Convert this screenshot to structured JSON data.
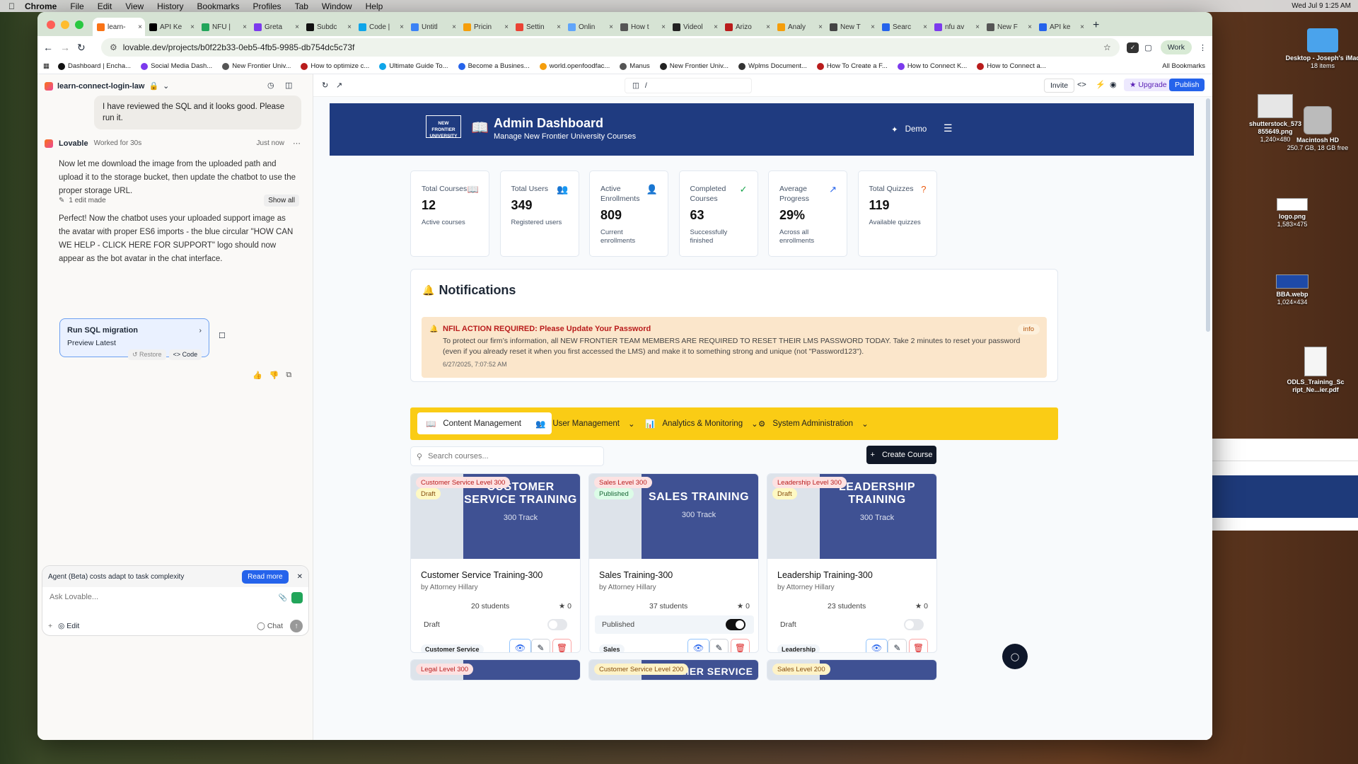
{
  "menubar": {
    "apple": "",
    "items": [
      "Chrome",
      "File",
      "Edit",
      "View",
      "History",
      "Bookmarks",
      "Profiles",
      "Tab",
      "Window",
      "Help"
    ],
    "clock": "Wed Jul 9  1:25 AM"
  },
  "desktop_icons": [
    {
      "name": "Desktop - Joseph's iMac",
      "sub": "18 items"
    },
    {
      "name": "shutterstock_573 855649.png",
      "sub": "1,240×480"
    },
    {
      "name": "Macintosh HD",
      "sub": "250.7 GB, 18 GB free"
    },
    {
      "name": "logo.png",
      "sub": "1,583×475"
    },
    {
      "name": "BBA.webp",
      "sub": "1,024×434"
    },
    {
      "name": "ODLS_Training_Sc ript_Ne...ier.pdf",
      "sub": ""
    }
  ],
  "tabs": [
    "learn-",
    "API Ke",
    "NFU |",
    "Greta",
    "Subdc",
    "Code |",
    "Untitl",
    "Pricin",
    "Settin",
    "Onlin",
    "How t",
    "Videol",
    "Arizo",
    "Analy",
    "New T",
    "Searc",
    "nfu av",
    "New F",
    "API ke"
  ],
  "omnibox": {
    "url": "lovable.dev/projects/b0f22b33-0eb5-4fb5-9985-db754dc5c73f",
    "profile": "Work"
  },
  "bookmarks": [
    "Dashboard | Encha...",
    "Social Media Dash...",
    "New Frontier Univ...",
    "How to optimize c...",
    "Ultimate Guide To...",
    "Become a Busines...",
    "world.openfoodfac...",
    "Manus",
    "New Frontier Univ...",
    "Wplms Document...",
    "How To Create a F...",
    "How to Connect K...",
    "How to Connect a..."
  ],
  "all_bookmarks": "All Bookmarks",
  "lovable": {
    "project": "learn-connect-login-law",
    "user_message": "I have reviewed the SQL and it looks good. Please run it.",
    "agent_name": "Lovable",
    "worked": "Worked for 30s",
    "time": "Just now",
    "reply1": "Now let me download the image from the uploaded path and upload it to the storage bucket, then update the chatbot to use the proper storage URL.",
    "edits": "1 edit made",
    "show_all": "Show all",
    "reply2": "Perfect! Now the chatbot uses your uploaded support image as the avatar with proper ES6 imports - the blue circular \"HOW CAN WE HELP - CLICK HERE FOR SUPPORT\" logo should now appear as the bot avatar in the chat interface.",
    "run_title": "Run SQL migration",
    "run_sub": "Preview Latest",
    "restore": "Restore",
    "code": "Code",
    "notice": "Agent (Beta) costs adapt to task complexity",
    "read_more": "Read more",
    "placeholder": "Ask Lovable...",
    "edit": "Edit",
    "chat": "Chat"
  },
  "app_toolbar": {
    "path": "/",
    "invite": "Invite",
    "upgrade": "Upgrade",
    "publish": "Publish"
  },
  "hero": {
    "title": "Admin Dashboard",
    "subtitle": "Manage New Frontier University Courses",
    "demo": "Demo",
    "logo": "NEW FRONTIER UNIVERSITY"
  },
  "stats": [
    {
      "label": "Total Courses",
      "value": "12",
      "sub": "Active courses",
      "color": "#2563eb"
    },
    {
      "label": "Total Users",
      "value": "349",
      "sub": "Registered users",
      "color": "#16a34a"
    },
    {
      "label": "Active Enrollments",
      "value": "809",
      "sub": "Current enrollments",
      "color": "#9333ea"
    },
    {
      "label": "Completed Courses",
      "value": "63",
      "sub": "Successfully finished",
      "color": "#16a34a"
    },
    {
      "label": "Average Progress",
      "value": "29%",
      "sub": "Across all enrollments",
      "color": "#2563eb"
    },
    {
      "label": "Total Quizzes",
      "value": "119",
      "sub": "Available quizzes",
      "color": "#ea580c"
    }
  ],
  "notifications": {
    "title": "Notifications",
    "item_title": "NFIL ACTION REQUIRED: Please Update Your Password",
    "item_body": "To protect our firm’s information, all NEW FRONTIER TEAM MEMBERS ARE REQUIRED TO RESET THEIR LMS PASSWORD TODAY. Take 2 minutes to reset your password (even if you already reset it when you first accessed the LMS) and make it to something strong and unique (not \"Password123\").",
    "item_date": "6/27/2025, 7:07:52 AM",
    "badge": "info"
  },
  "nav_menu": [
    "Content Management",
    "User Management",
    "Analytics & Monitoring",
    "System Administration"
  ],
  "search": {
    "placeholder": "Search courses..."
  },
  "create_course": "Create Course",
  "courses": [
    {
      "level": "Customer Service Level 300",
      "status": "Draft",
      "banner": "CUSTOMER SERVICE TRAINING",
      "track": "300 Track",
      "title": "Customer Service Training-300",
      "author": "by Attorney Hillary",
      "students": "20 students",
      "rating": "0",
      "state": "Draft",
      "published": false,
      "category": "Customer Service"
    },
    {
      "level": "Sales Level 300",
      "status": "Published",
      "banner": "SALES TRAINING",
      "track": "300 Track",
      "title": "Sales Training-300",
      "author": "by Attorney Hillary",
      "students": "37 students",
      "rating": "0",
      "state": "Published",
      "published": true,
      "category": "Sales"
    },
    {
      "level": "Leadership Level 300",
      "status": "Draft",
      "banner": "LEADERSHIP TRAINING",
      "track": "300 Track",
      "title": "Leadership Training-300",
      "author": "by Attorney Hillary",
      "students": "23 students",
      "rating": "0",
      "state": "Draft",
      "published": false,
      "category": "Leadership"
    }
  ],
  "courses_row2": [
    {
      "level": "Legal Level 300"
    },
    {
      "level": "Customer Service Level 200",
      "banner": "CUSTOMER SERVICE"
    },
    {
      "level": "Sales Level 200"
    }
  ]
}
